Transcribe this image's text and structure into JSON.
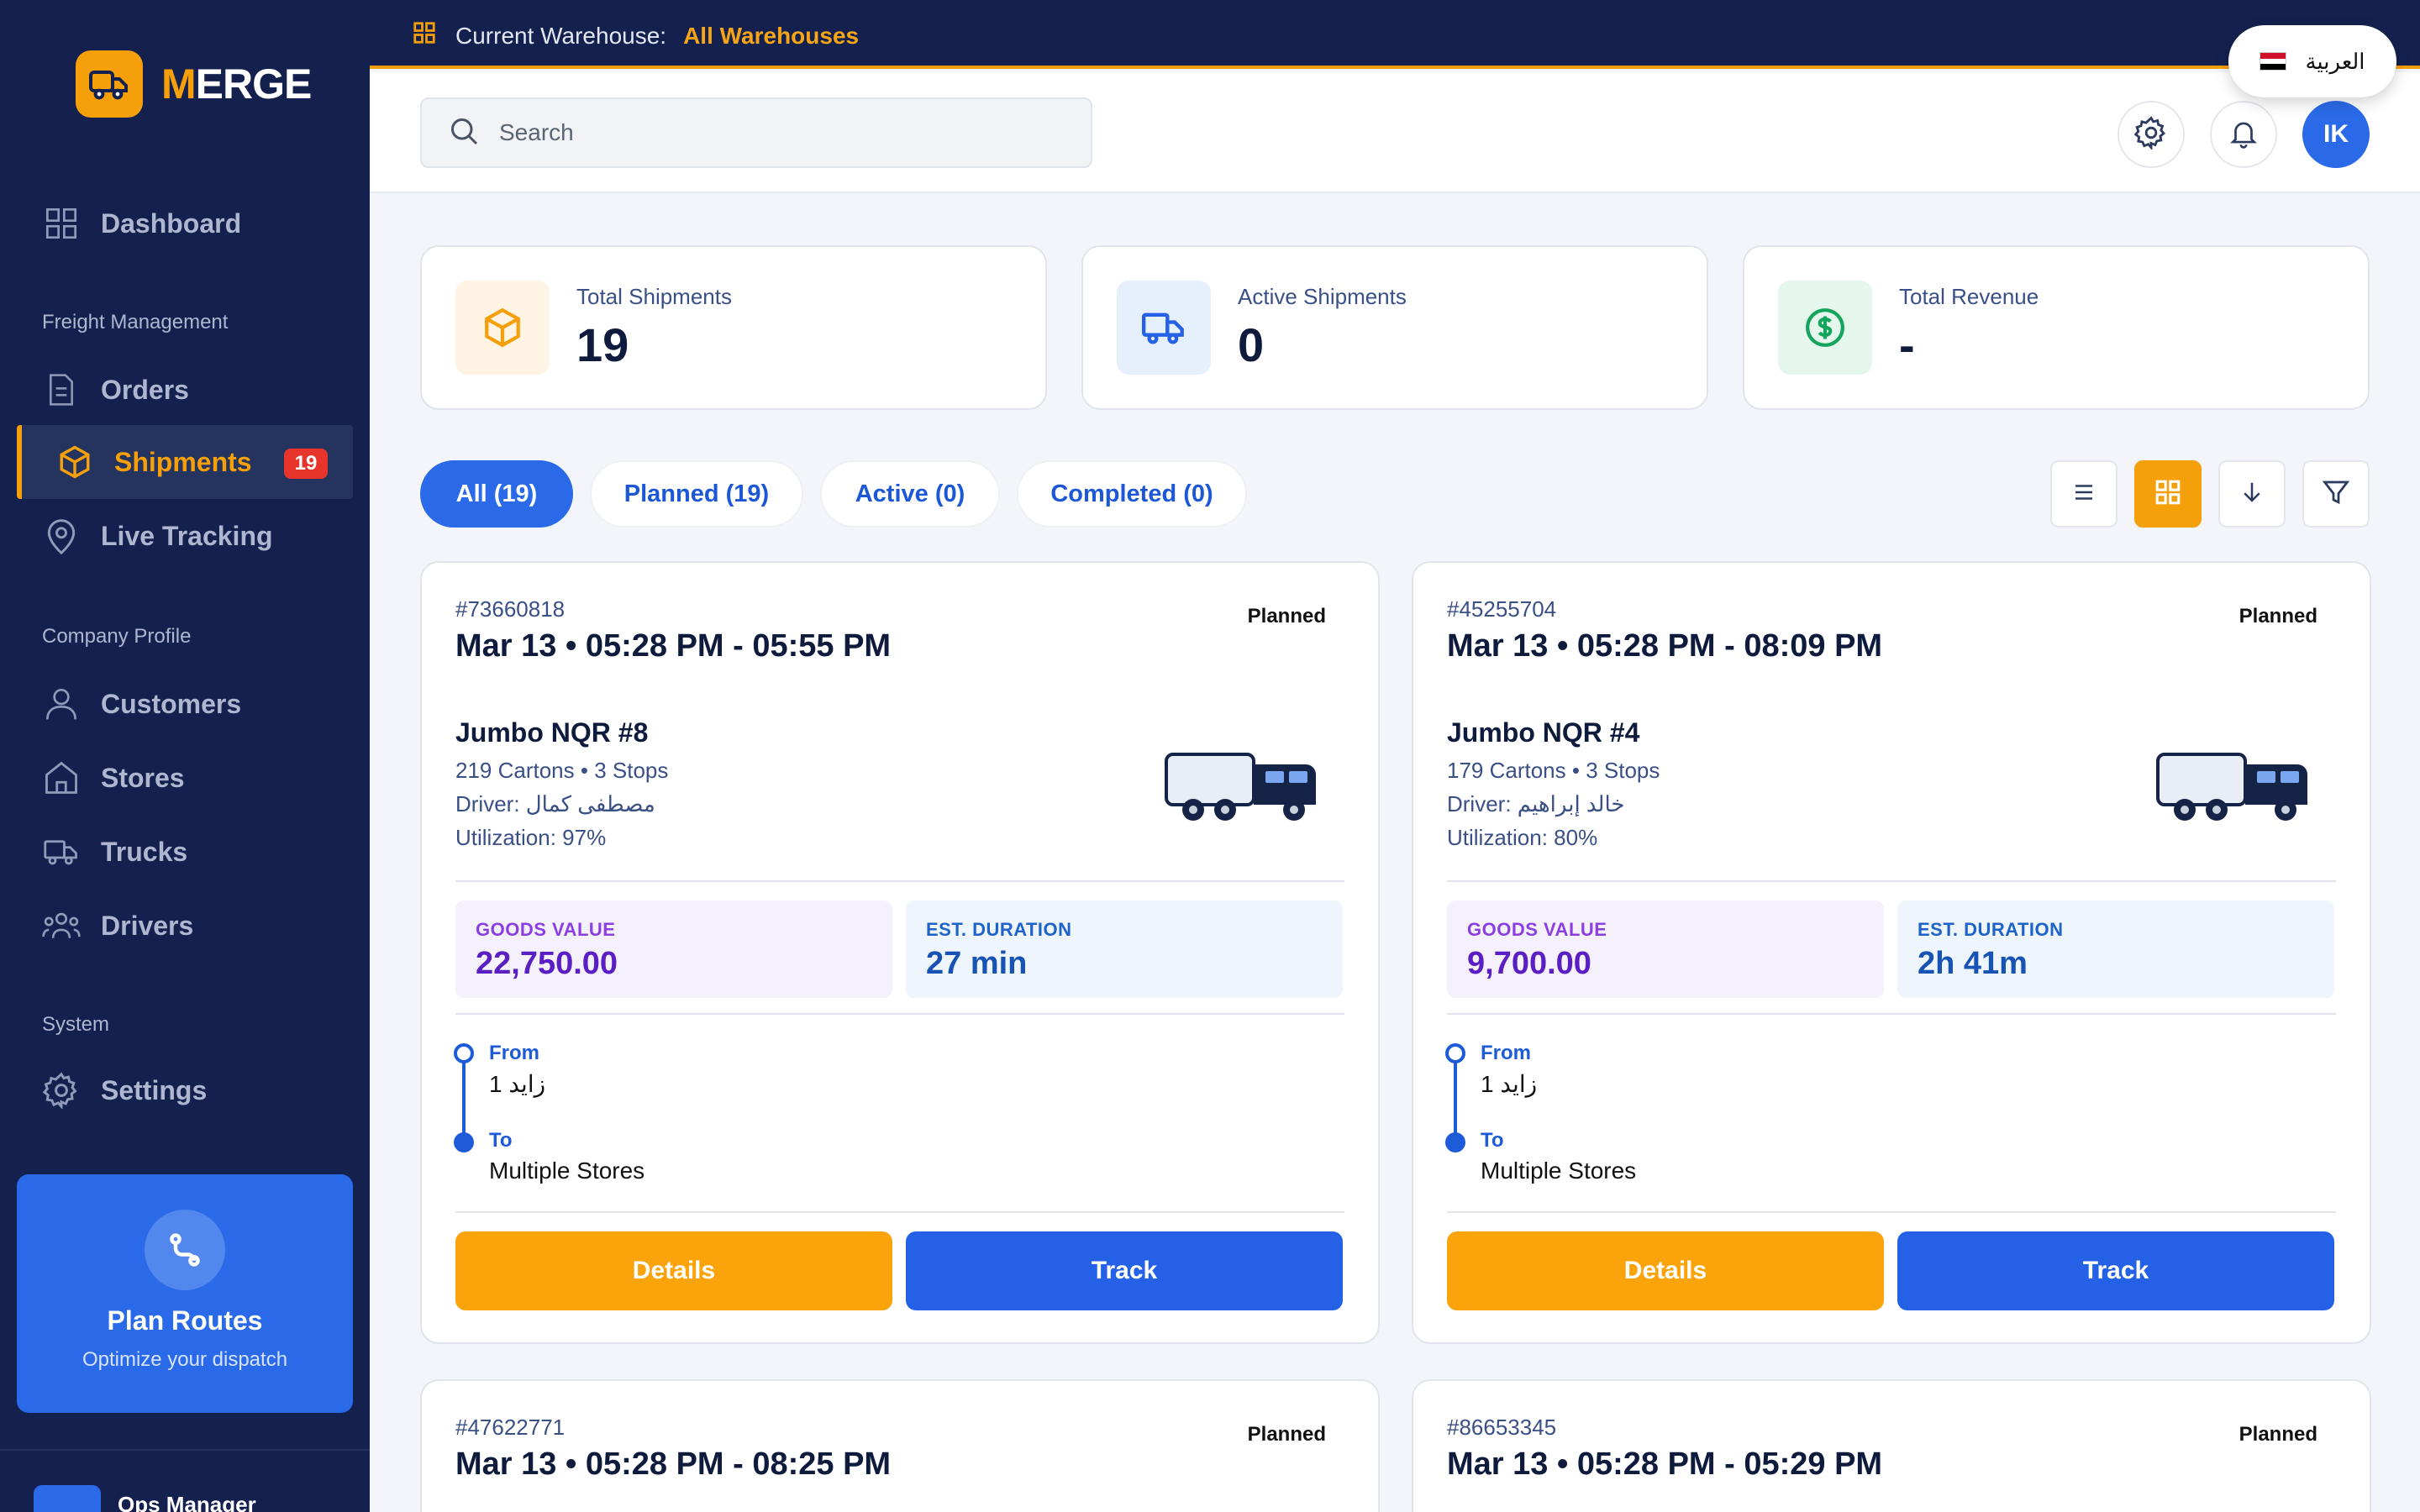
{
  "app": {
    "name_prefix": "M",
    "name_rest": "ERGE"
  },
  "topbar": {
    "warehouse_label": "Current Warehouse:",
    "warehouse_value": "All Warehouses",
    "language": "العربية"
  },
  "sidebar": {
    "dashboard": "Dashboard",
    "section_freight": "Freight Management",
    "orders": "Orders",
    "shipments": "Shipments",
    "shipments_badge": "19",
    "live_tracking": "Live Tracking",
    "section_company": "Company Profile",
    "customers": "Customers",
    "stores": "Stores",
    "trucks": "Trucks",
    "drivers": "Drivers",
    "section_system": "System",
    "settings": "Settings",
    "plan_title": "Plan Routes",
    "plan_subtitle": "Optimize your dispatch",
    "user_role": "Ops Manager"
  },
  "header": {
    "search_placeholder": "Search",
    "avatar_initials": "IK"
  },
  "stats": [
    {
      "label": "Total Shipments",
      "value": "19"
    },
    {
      "label": "Active Shipments",
      "value": "0"
    },
    {
      "label": "Total Revenue",
      "value": "-"
    }
  ],
  "filters": [
    "All (19)",
    "Planned (19)",
    "Active (0)",
    "Completed (0)"
  ],
  "card_labels": {
    "goods": "GOODS VALUE",
    "duration": "EST. DURATION",
    "from": "From",
    "to": "To",
    "details": "Details",
    "track": "Track"
  },
  "shipments": [
    {
      "id": "#73660818",
      "status": "Planned",
      "time": "Mar 13 • 05:28 PM - 05:55 PM",
      "truck": "Jumbo NQR #8",
      "cartons": "219 Cartons • 3 Stops",
      "driver": "Driver: مصطفى كمال",
      "utilization": "Utilization: 97%",
      "goods_value": "22,750.00",
      "duration": "27 min",
      "from": "زايد 1",
      "to": "Multiple Stores"
    },
    {
      "id": "#45255704",
      "status": "Planned",
      "time": "Mar 13 • 05:28 PM - 08:09 PM",
      "truck": "Jumbo NQR #4",
      "cartons": "179 Cartons • 3 Stops",
      "driver": "Driver: خالد إبراهيم",
      "utilization": "Utilization: 80%",
      "goods_value": "9,700.00",
      "duration": "2h 41m",
      "from": "زايد 1",
      "to": "Multiple Stores"
    },
    {
      "id": "#47622771",
      "status": "Planned",
      "time": "Mar 13 • 05:28 PM - 08:25 PM"
    },
    {
      "id": "#86653345",
      "status": "Planned",
      "time": "Mar 13 • 05:28 PM - 05:29 PM"
    }
  ],
  "colors": {
    "navy": "#14214f",
    "accent": "#f59f0a",
    "primary": "#2a6ae9",
    "badge": "#e8352b"
  },
  "icons": [
    "truck-icon",
    "dashboard-icon",
    "document-icon",
    "box-icon",
    "map-pin-icon",
    "user-icon",
    "store-icon",
    "drivers-icon",
    "gear-icon",
    "route-icon",
    "grid-icon",
    "search-icon",
    "bell-icon",
    "list-icon",
    "arrow-down-icon",
    "filter-icon",
    "dollar-icon"
  ]
}
